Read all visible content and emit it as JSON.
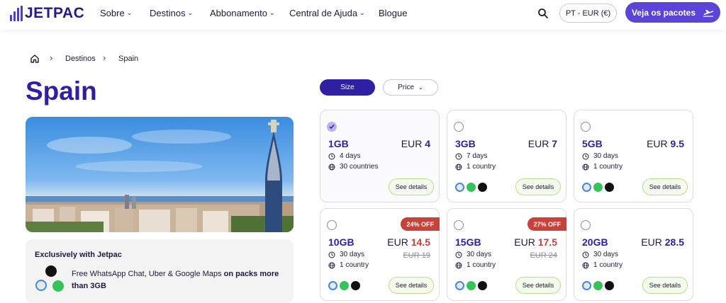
{
  "header": {
    "logo_text": "JETPAC",
    "nav": [
      {
        "label": "Sobre"
      },
      {
        "label": "Destinos"
      },
      {
        "label": "Abbonamento"
      },
      {
        "label": "Central de Ajuda"
      },
      {
        "label": "Blogue"
      }
    ],
    "currency": "PT - EUR (€)",
    "cta_label": "Veja os pacotes"
  },
  "breadcrumb": {
    "items": [
      "Destinos",
      "Spain"
    ]
  },
  "page_title": "Spain",
  "promo": {
    "heading": "Exclusively with Jetpac",
    "text_plain": "Free WhatsApp Chat, Uber & Google Maps ",
    "text_bold": "on packs more than 3GB"
  },
  "filters": {
    "size": "Size",
    "price": "Price"
  },
  "currency_label": "EUR",
  "details_label": "See details",
  "colors": {
    "accent": "#2f1fa3",
    "brand": "#5b44d8",
    "sale": "#c8423c",
    "details_border": "#b6e08c"
  },
  "packs": [
    {
      "size": "1GB",
      "price": "4",
      "days": "4 days",
      "coverage": "30 countries",
      "selected": true,
      "apps": false
    },
    {
      "size": "3GB",
      "price": "7",
      "days": "7 days",
      "coverage": "1 country",
      "selected": false,
      "apps": true
    },
    {
      "size": "5GB",
      "price": "9.5",
      "days": "30 days",
      "coverage": "1 country",
      "selected": false,
      "apps": true
    },
    {
      "size": "10GB",
      "price": "14.5",
      "old_price": "EUR 19",
      "discount": "24% OFF",
      "days": "30 days",
      "coverage": "1 country",
      "selected": false,
      "apps": true
    },
    {
      "size": "15GB",
      "price": "17.5",
      "old_price": "EUR 24",
      "discount": "27% OFF",
      "days": "30 days",
      "coverage": "1 country",
      "selected": false,
      "apps": true
    },
    {
      "size": "20GB",
      "price": "28.5",
      "days": "30 days",
      "coverage": "1 country",
      "selected": false,
      "apps": true
    }
  ]
}
